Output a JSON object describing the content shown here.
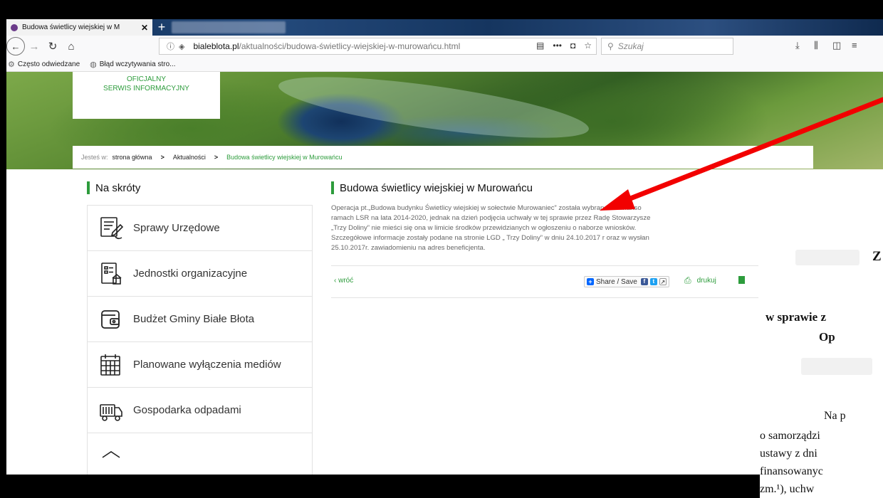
{
  "browser": {
    "tab_title": "Budowa świetlicy wiejskiej w M",
    "tab_close": "✕",
    "tab_new": "+",
    "url_host": "bialeblota.pl",
    "url_path": "/aktualności/budowa-świetlicy-wiejskiej-w-murowańcu.html",
    "search_placeholder": "Szukaj",
    "bookmarks": [
      "Często odwiedzane",
      "Błąd wczytywania stro..."
    ]
  },
  "site": {
    "logo_line1": "OFICJALNY",
    "logo_line2": "SERWIS INFORMACYJNY",
    "breadcrumb": {
      "lead": "Jesteś w:",
      "items": [
        "strona główna",
        "Aktualności",
        "Budowa świetlicy wiejskiej w Murowańcu"
      ],
      "separator": ">"
    }
  },
  "shortcuts": {
    "title": "Na skróty",
    "items": [
      {
        "label": "Sprawy Urzędowe",
        "icon": "document-pen-icon"
      },
      {
        "label": "Jednostki organizacyjne",
        "icon": "org-chart-icon"
      },
      {
        "label": "Budżet Gminy Białe Błota",
        "icon": "wallet-icon"
      },
      {
        "label": "Planowane wyłączenia mediów",
        "icon": "calendar-icon"
      },
      {
        "label": "Gospodarka odpadami",
        "icon": "garbage-truck-icon"
      }
    ]
  },
  "article": {
    "title": "Budowa świetlicy wiejskiej w Murowańcu",
    "lines": [
      "Operacja pt.„Budowa budynku Świetlicy wiejskiej w sołectwie Murowaniec” została wybrana do finanso",
      "ramach LSR na lata 2014-2020, jednak na dzień podjęcia uchwały w tej sprawie przez Radę Stowarzysze",
      "„Trzy Doliny” nie mieści się ona w limicie środków  przewidzianych w ogłoszeniu o naborze wniosków.",
      "Szczegółowe informacje zostały podane na stronie LGD „ Trzy Doliny” w dniu 24.10.2017 r oraz w wysłan",
      "25.10.2017r. zawiadomieniu  na adres beneficjenta."
    ],
    "back_label": "wróć",
    "share_label": "Share / Save",
    "print_label": "drukuj"
  },
  "document_overlay": {
    "letter": "Z",
    "heading1": "w sprawie z",
    "heading2": "Op",
    "body": [
      "Na p",
      "o samorządzi",
      "ustawy z dni",
      "finansowanyc",
      "zm.¹), uchw"
    ]
  },
  "colors": {
    "accent_green": "#2d9c3c",
    "arrow_red": "#f20000"
  }
}
